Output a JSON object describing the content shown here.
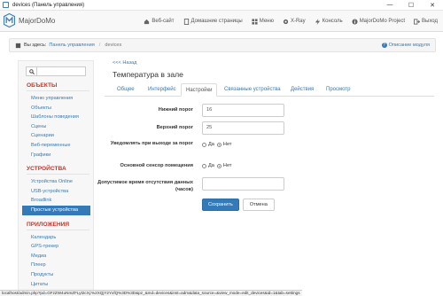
{
  "window": {
    "title": "devices (Панель управления)",
    "minimize": "—",
    "maximize": "☐",
    "close": "✕"
  },
  "brand": {
    "name": "MajorDoMo"
  },
  "nav": [
    {
      "label": "Веб-сайт",
      "icon": "home-icon"
    },
    {
      "label": "Домашние страницы",
      "icon": "file-icon"
    },
    {
      "label": "Меню",
      "icon": "grid-icon"
    },
    {
      "label": "X-Ray",
      "icon": "eye-icon"
    },
    {
      "label": "Консоль",
      "icon": "bolt-icon"
    },
    {
      "label": "MajorDoMo Project",
      "icon": "info-icon"
    },
    {
      "label": "Выход",
      "icon": "logout-icon"
    }
  ],
  "breadcrumb": {
    "prefix": "Вы здесь:",
    "link": "Панель управления",
    "separator": "/",
    "current": "devices",
    "help": "Описание модуля"
  },
  "sidebar": {
    "sections": [
      {
        "title": "ОБЪЕКТЫ",
        "items": [
          "Меню управления",
          "Объекты",
          "Шаблоны поведения",
          "Сцены",
          "Сценарии",
          "Веб-переменные",
          "Графики"
        ]
      },
      {
        "title": "УСТРОЙСТВА",
        "items": [
          "Устройства Online",
          "USB-устройства",
          "Broadlink",
          "Простые устройства"
        ]
      },
      {
        "title": "ПРИЛОЖЕНИЯ",
        "items": [
          "Календарь",
          "GPS-трекер",
          "Медиа",
          "Плеер",
          "Продукты",
          "Цитаты"
        ]
      }
    ],
    "active_item": "Простые устройства"
  },
  "main": {
    "back": "<<< Назад",
    "title": "Температура в зале",
    "tabs": [
      "Общее",
      "Интерфейс",
      "Настройки",
      "Связанные устройства",
      "Действия",
      "Просмотр"
    ],
    "active_tab": "Настройки"
  },
  "form": {
    "low_label": "Нижний порог",
    "low_value": "16",
    "high_label": "Верхний порог",
    "high_value": "25",
    "notify_label": "Уведомлять при выходе за порог",
    "main_sensor_label": "Основной сенсор помещения",
    "absence_label": "Допустимое время отсутствия данных (часов)",
    "absence_value": "",
    "yes": "Да",
    "no": "Нет",
    "notify_selected": "Нет",
    "main_sensor_selected": "Нет",
    "save": "Сохранить",
    "cancel": "Отмена"
  },
  "status_url": "localhost/admin.php?pd=GFzZW4uNmZFLyt2cXj:%2XQjY2YxfQ%3D%3D&pz_&md=devices&inst=adm&data_source=&view_mode=edit_devices&id=1&tab=settings",
  "colors": {
    "accent": "#337ab7",
    "section": "#c0392b"
  }
}
